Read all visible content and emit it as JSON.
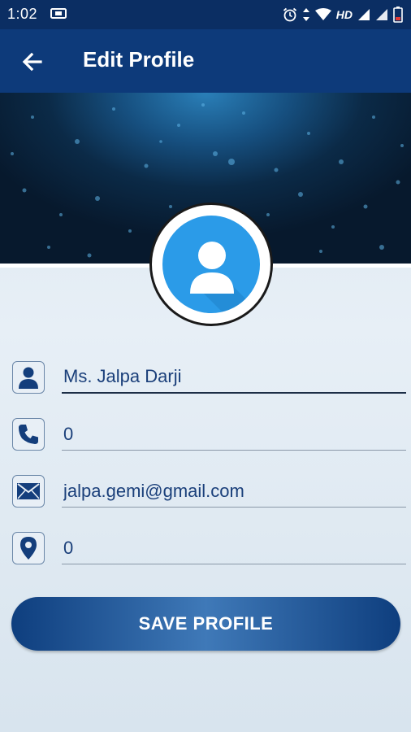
{
  "status_bar": {
    "time": "1:02",
    "hd_label": "HD",
    "icons": [
      "screen-share-icon",
      "alarm-icon",
      "data-arrows-icon",
      "wifi-icon",
      "signal-icon",
      "signal-icon",
      "battery-low-icon"
    ]
  },
  "app_bar": {
    "title": "Edit Profile",
    "back_icon": "arrow-left-icon"
  },
  "profile": {
    "avatar_icon": "user-avatar-icon"
  },
  "form": {
    "fields": [
      {
        "icon": "person-icon",
        "value": "Ms. Jalpa Darji"
      },
      {
        "icon": "phone-icon",
        "value": "0"
      },
      {
        "icon": "envelope-icon",
        "value": "jalpa.gemi@gmail.com"
      },
      {
        "icon": "location-pin-icon",
        "value": "0"
      }
    ],
    "save_label": "SAVE PROFILE"
  },
  "colors": {
    "app_bar": "#0d3a7a",
    "status_bar": "#0b2e63",
    "avatar_bg": "#2b9be8",
    "text": "#1a3f7a"
  }
}
